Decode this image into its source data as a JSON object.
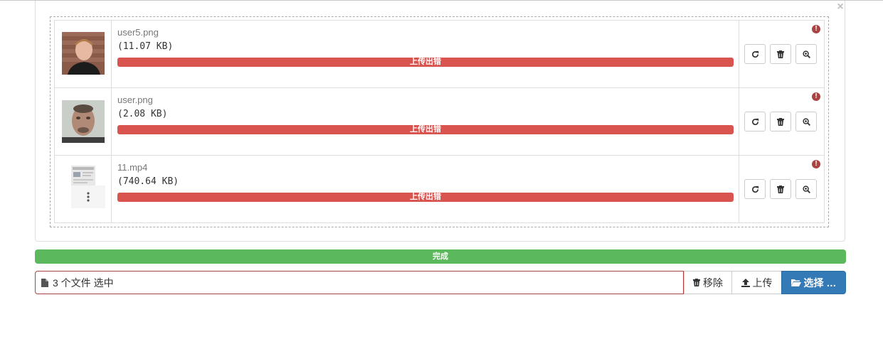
{
  "preview": {
    "close_label": "×",
    "files": [
      {
        "name": "user5.png",
        "size": "(11.07 KB)",
        "status": "上传出错",
        "thumb": "photo-portrait-red-brick"
      },
      {
        "name": "user.png",
        "size": "(2.08 KB)",
        "status": "上传出错",
        "thumb": "photo-portrait-blurred"
      },
      {
        "name": "11.mp4",
        "size": "(740.64 KB)",
        "status": "上传出错",
        "thumb": "video-thumbnail"
      }
    ],
    "error_icon_label": "!",
    "actions": [
      "retry-icon",
      "trash-icon",
      "zoom-in-icon"
    ]
  },
  "overall_progress": {
    "label": "完成",
    "percent": 100,
    "color": "#5cb85c"
  },
  "caption": {
    "text": "3 个文件 选中"
  },
  "buttons": {
    "remove": "移除",
    "upload": "上传",
    "browse": "选择 …"
  },
  "colors": {
    "error": "#d9534f",
    "primary": "#337ab7",
    "success": "#5cb85c"
  }
}
